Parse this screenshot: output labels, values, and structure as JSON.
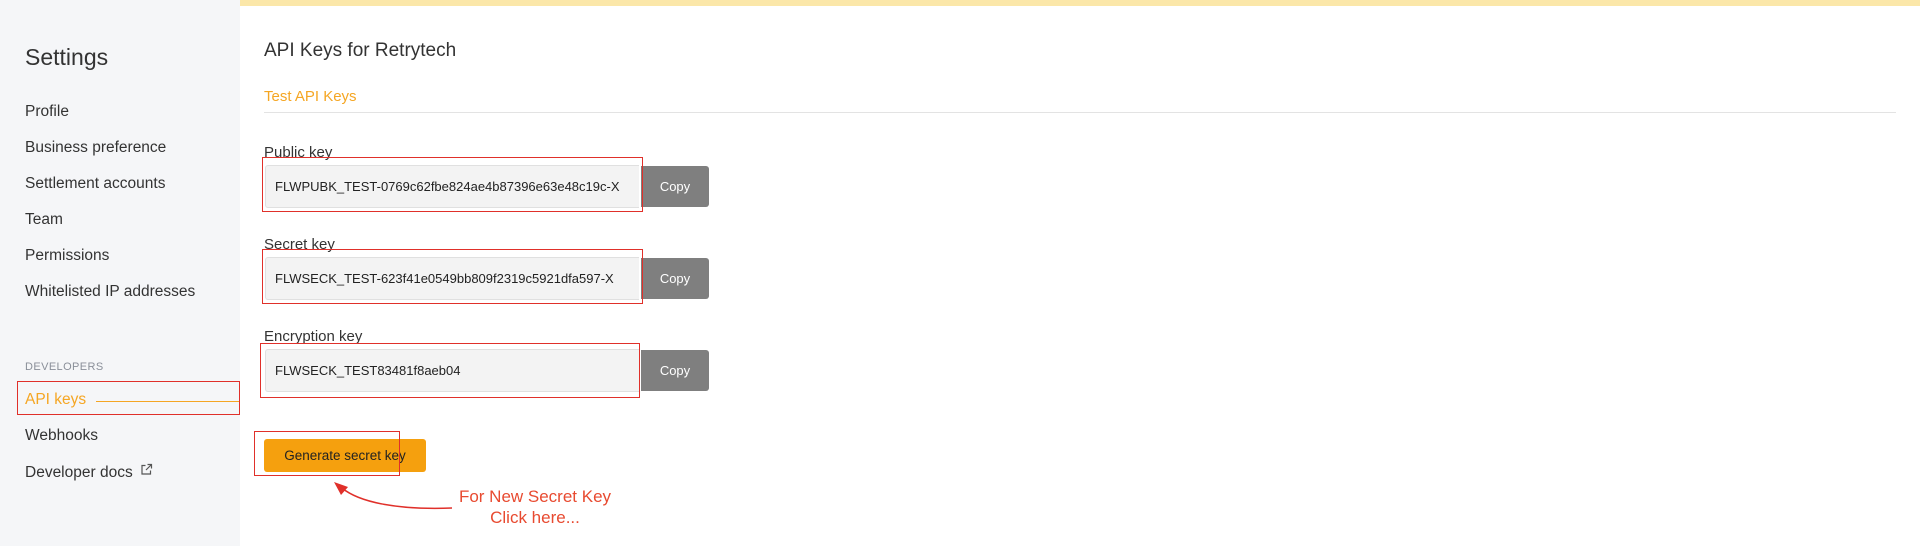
{
  "sidebar": {
    "title": "Settings",
    "items": [
      {
        "label": "Profile"
      },
      {
        "label": "Business preference"
      },
      {
        "label": "Settlement accounts"
      },
      {
        "label": "Team"
      },
      {
        "label": "Permissions"
      },
      {
        "label": "Whitelisted IP addresses"
      }
    ],
    "developers_section": "DEVELOPERS",
    "dev_items": [
      {
        "label": "API keys",
        "active": true
      },
      {
        "label": "Webhooks"
      },
      {
        "label": "Developer docs",
        "external_icon": "external-link-icon"
      }
    ]
  },
  "main": {
    "title": "API Keys for Retrytech",
    "tabs": [
      {
        "label": "Test API Keys",
        "active": true
      }
    ],
    "keys": [
      {
        "label": "Public key",
        "value": "FLWPUBK_TEST-0769c62fbe824ae4b87396e63e48c19c-X",
        "button": "Copy"
      },
      {
        "label": "Secret key",
        "value": "FLWSECK_TEST-623f41e0549bb809f2319c5921dfa597-X",
        "button": "Copy"
      },
      {
        "label": "Encryption key",
        "value": "FLWSECK_TEST83481f8aeb04",
        "button": "Copy"
      }
    ],
    "generate_button": "Generate secret key"
  },
  "annotation": {
    "line1": "For New Secret Key",
    "line2": "Click here..."
  },
  "colors": {
    "accent": "#f5a623",
    "annotation": "#e0302a",
    "copy_button": "#7f7f7f",
    "top_banner": "#fbe7a9"
  }
}
